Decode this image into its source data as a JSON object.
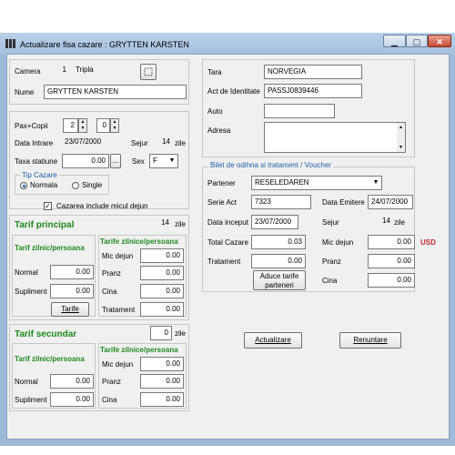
{
  "window": {
    "title": "Actualizare fisa cazare : GRYTTEN KARSTEN",
    "min": "▁",
    "max": "▢",
    "close": "✕"
  },
  "guest": {
    "camera_label": "Camera",
    "camera_no": "1",
    "camera_type": "Tripla",
    "nume_label": "Nume",
    "nume": "GRYTTEN KARSTEN"
  },
  "stay": {
    "pax_label": "Pax+Copii",
    "pax": "2",
    "copii": "0",
    "data_intrare_label": "Data Intrare",
    "data_intrare": "23/07/2000",
    "sejur_label": "Sejur",
    "sejur": "14",
    "zile": "zile",
    "taxa_label": "Taxa statiune",
    "taxa": "0.00",
    "taxa_btn": "...",
    "sex_label": "Sex",
    "sex": "F",
    "tip_label": "Tip Cazare",
    "normala": "Normala",
    "single": "Single",
    "micul_dejun_label": "Cazarea include micul dejun"
  },
  "tarif_principal": {
    "title": "Tarif principal",
    "days": "14",
    "zile": "zile",
    "col_left": "Tarif zilnic/persoana",
    "col_right": "Tarife zilnice/persoana",
    "normal_label": "Normal",
    "normal": "0.00",
    "supliment_label": "Supliment",
    "supliment": "0.00",
    "tarife_button": "Tarife",
    "mic_dejun_label": "Mic dejun",
    "mic_dejun": "0.00",
    "pranz_label": "Pranz",
    "pranz": "0.00",
    "cina_label": "Cina",
    "cina": "0.00",
    "tratament_label": "Tratament",
    "tratament": "0.00"
  },
  "tarif_secundar": {
    "title": "Tarif secundar",
    "days": "0",
    "zile": "zile",
    "col_left": "Tarif zilnic/persoana",
    "col_right": "Tarife zilnice/persoana",
    "normal_label": "Normal",
    "normal": "0.00",
    "supliment_label": "Supliment",
    "supliment": "0.00",
    "mic_dejun_label": "Mic dejun",
    "mic_dejun": "0.00",
    "pranz_label": "Pranz",
    "pranz": "0.00",
    "cina_label": "Cina",
    "cina": "0.00"
  },
  "identity": {
    "tara_label": "Tara",
    "tara": "NORVEGIA",
    "act_label": "Act de Identitate",
    "act": "PASSJ0839446",
    "auto_label": "Auto",
    "auto": "",
    "adresa_label": "Adresa",
    "adresa": ""
  },
  "voucher": {
    "title": "Bilet de odihna si tratament / Voucher",
    "partener_label": "Partener",
    "partener": "RESELEDAREN",
    "serie_label": "Serie Act",
    "serie": "7323",
    "data_emitere_label": "Data Emitere",
    "data_emitere": "24/07/2000",
    "data_inceput_label": "Data inceput",
    "data_inceput": "23/07/2000",
    "sejur_label": "Sejur",
    "sejur": "14",
    "zile": "zile",
    "total_label": "Total Cazare",
    "total": "0.03",
    "mic_dejun_label": "Mic dejun",
    "mic_dejun": "0.00",
    "currency": "USD",
    "tratament_label": "Tratament",
    "tratament": "0.00",
    "pranz_label": "Pranz",
    "pranz": "0.00",
    "aduce_button": "Aduce tarife parteneri",
    "cina_label": "Cina",
    "cina": "0.00"
  },
  "actions": {
    "actualizare": "Actualizare",
    "renuntare": "Renuntare"
  },
  "icons": [
    "app-icon",
    "minimize-icon",
    "maximize-icon",
    "close-icon",
    "lookup-icon",
    "calendar-icon",
    "chevron-down-icon",
    "spin-up-icon",
    "spin-down-icon"
  ]
}
